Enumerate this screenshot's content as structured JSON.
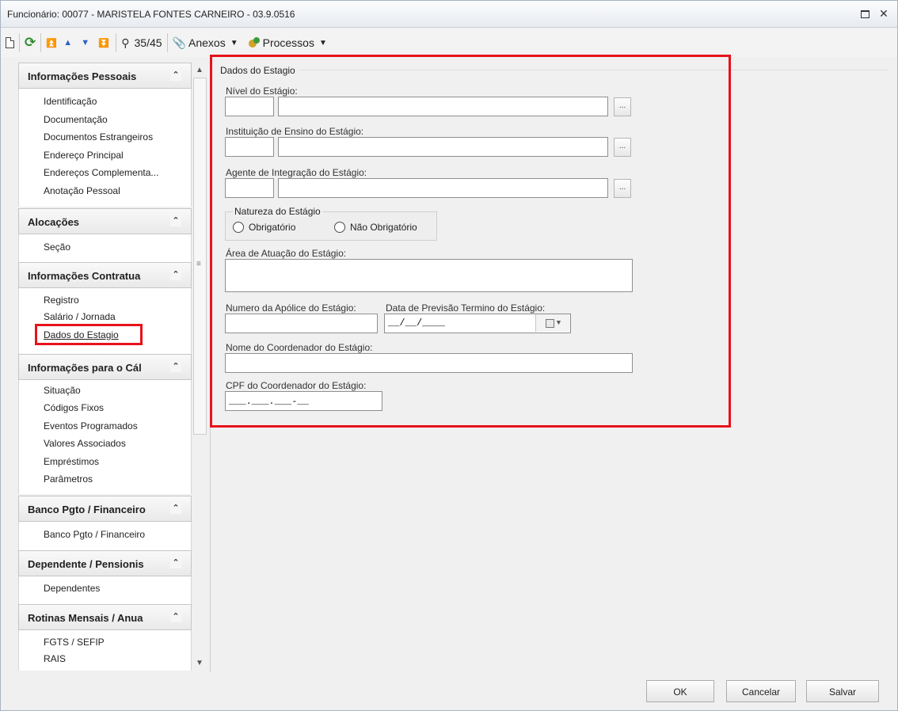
{
  "window": {
    "title": "Funcionário: 00077 - MARISTELA FONTES CARNEIRO - 03.9.0516",
    "maximize_icon": "maximize-icon",
    "close_icon": "close-icon",
    "close_glyph": "✕"
  },
  "toolbar": {
    "record_counter": "35/45",
    "attachments_label": "Anexos",
    "processes_label": "Processos",
    "icons": [
      "new-document-icon",
      "refresh-icon",
      "first-record-icon",
      "previous-record-icon",
      "next-record-icon",
      "last-record-icon",
      "search-icon",
      "attachments-icon",
      "processes-icon"
    ]
  },
  "sidebar": {
    "sections": [
      {
        "title": "Informações Pessoais",
        "items": [
          "Identificação",
          "Documentação",
          "Documentos Estrangeiros",
          "Endereço Principal",
          "Endereços Complementa...",
          "Anotação Pessoal"
        ]
      },
      {
        "title": "Alocações",
        "items": [
          "Seção"
        ]
      },
      {
        "title": "Informações Contratua",
        "items": [
          "Registro",
          "Salário / Jornada",
          "Dados do Estagio"
        ]
      },
      {
        "title": "Informações para o Cál",
        "items": [
          "Situação",
          "Códigos Fixos",
          "Eventos Programados",
          "Valores Associados",
          "Empréstimos",
          "Parâmetros"
        ]
      },
      {
        "title": "Banco Pgto / Financeiro",
        "items": [
          "Banco Pgto / Financeiro"
        ]
      },
      {
        "title": "Dependente / Pensionis",
        "items": [
          "Dependentes"
        ]
      },
      {
        "title": "Rotinas Mensais / Anua",
        "items": [
          "FGTS / SEFIP",
          "RAIS"
        ]
      }
    ],
    "active_item": "Dados do Estagio"
  },
  "form": {
    "group_title": "Dados do Estagio",
    "nivel_label": "Nível do Estágio:",
    "instituicao_label": "Instituição de Ensino do Estágio:",
    "agente_label": "Agente de Integração do Estágio:",
    "lookup_button": "...",
    "natureza_legend": "Natureza do Estágio",
    "natureza_options": [
      "Obrigatório",
      "Não Obrigatório"
    ],
    "area_label": "Área de Atuação do Estágio:",
    "apolice_label": "Numero da Apólice do Estágio:",
    "previsao_label": "Data de Previsão Termino do Estágio:",
    "previsao_value": "__/__/____",
    "coordenador_label": "Nome do Coordenador do Estágio:",
    "cpf_label": "CPF do Coordenador do Estágio:",
    "cpf_value": "___.___.___-__"
  },
  "footer": {
    "ok_label": "OK",
    "cancel_label": "Cancelar",
    "save_label": "Salvar"
  },
  "colors": {
    "highlight": "#e8121b",
    "nav_arrows": "#2a63c5",
    "refresh": "#2d8a2d"
  }
}
